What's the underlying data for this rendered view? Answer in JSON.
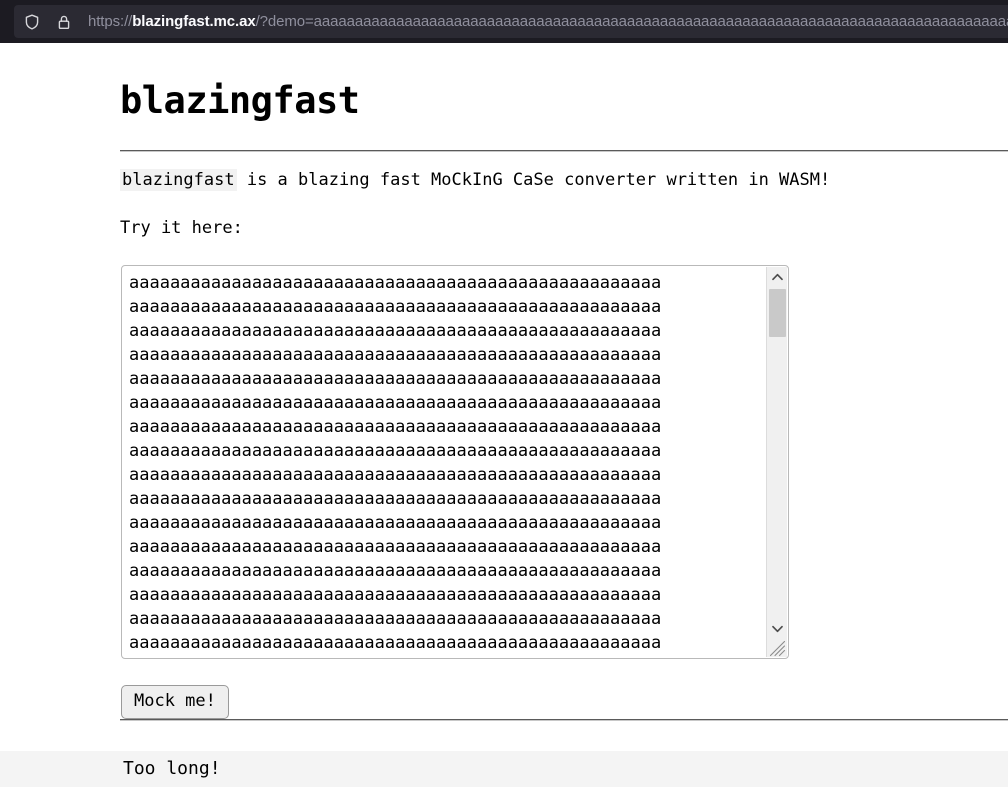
{
  "browser": {
    "shield_icon": "shield-icon",
    "lock_icon": "padlock-icon",
    "url": {
      "scheme": "https://",
      "host": "blazingfast.mc.ax",
      "path_query": "/?demo=aaaaaaaaaaaaaaaaaaaaaaaaaaaaaaaaaaaaaaaaaaaaaaaaaaaaaaaaaaaaaaaaaaaaaaaaaaaaaaaaaaaaaaaaaa"
    }
  },
  "page": {
    "title": "blazingfast",
    "intro": {
      "code": "blazingfast",
      "rest": " is a blazing fast MoCkInG CaSe converter written in WASM!"
    },
    "try_label": "Try it here:",
    "input": {
      "value": "aaaaaaaaaaaaaaaaaaaaaaaaaaaaaaaaaaaaaaaaaaaaaaaaaaaa\naaaaaaaaaaaaaaaaaaaaaaaaaaaaaaaaaaaaaaaaaaaaaaaaaaaa\naaaaaaaaaaaaaaaaaaaaaaaaaaaaaaaaaaaaaaaaaaaaaaaaaaaa\naaaaaaaaaaaaaaaaaaaaaaaaaaaaaaaaaaaaaaaaaaaaaaaaaaaa\naaaaaaaaaaaaaaaaaaaaaaaaaaaaaaaaaaaaaaaaaaaaaaaaaaaa\naaaaaaaaaaaaaaaaaaaaaaaaaaaaaaaaaaaaaaaaaaaaaaaaaaaa\naaaaaaaaaaaaaaaaaaaaaaaaaaaaaaaaaaaaaaaaaaaaaaaaaaaa\naaaaaaaaaaaaaaaaaaaaaaaaaaaaaaaaaaaaaaaaaaaaaaaaaaaa\naaaaaaaaaaaaaaaaaaaaaaaaaaaaaaaaaaaaaaaaaaaaaaaaaaaa\naaaaaaaaaaaaaaaaaaaaaaaaaaaaaaaaaaaaaaaaaaaaaaaaaaaa\naaaaaaaaaaaaaaaaaaaaaaaaaaaaaaaaaaaaaaaaaaaaaaaaaaaa\naaaaaaaaaaaaaaaaaaaaaaaaaaaaaaaaaaaaaaaaaaaaaaaaaaaa\naaaaaaaaaaaaaaaaaaaaaaaaaaaaaaaaaaaaaaaaaaaaaaaaaaaa\naaaaaaaaaaaaaaaaaaaaaaaaaaaaaaaaaaaaaaaaaaaaaaaaaaaa\naaaaaaaaaaaaaaaaaaaaaaaaaaaaaaaaaaaaaaaaaaaaaaaaaaaa\naaaaaaaaaaaaaaaaaaaaaaaaaaaaaaaaaaaaaaaaaaaaaaaaaaaa",
      "placeholder": ""
    },
    "submit_label": "Mock me!",
    "output": "Too long!"
  },
  "colors": {
    "chrome_bg": "#1c1b22",
    "urlbar_bg": "#2b2a33",
    "url_host": "#fbfbfe",
    "url_dim": "#8f8f9d",
    "page_bg": "#ffffff",
    "code_bg": "#f2f2f2",
    "output_bg": "#f4f4f4",
    "button_bg": "#efefef",
    "border": "#b9b9b9",
    "scroll_thumb": "#c9c9c9"
  }
}
